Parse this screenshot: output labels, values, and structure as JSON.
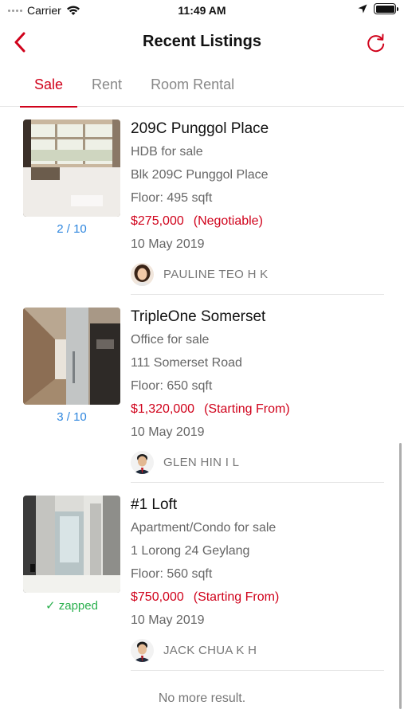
{
  "status_bar": {
    "carrier": "Carrier",
    "time": "11:49 AM"
  },
  "nav": {
    "title": "Recent Listings",
    "back_icon": "chevron-left-icon",
    "refresh_icon": "refresh-icon"
  },
  "tabs": [
    {
      "label": "Sale",
      "active": true
    },
    {
      "label": "Rent",
      "active": false
    },
    {
      "label": "Room Rental",
      "active": false
    }
  ],
  "listings": [
    {
      "title": "209C Punggol Place",
      "type": "HDB for sale",
      "address": "Blk 209C Punggol Place",
      "floor": "Floor: 495 sqft",
      "price": "$275,000",
      "price_note": "(Negotiable)",
      "date": "10 May 2019",
      "photo_label": "2 / 10",
      "agent": "PAULINE TEO H K"
    },
    {
      "title": "TripleOne Somerset",
      "type": "Office for sale",
      "address": "111 Somerset Road",
      "floor": "Floor: 650 sqft",
      "price": "$1,320,000",
      "price_note": "(Starting From)",
      "date": "10 May 2019",
      "photo_label": "3 / 10",
      "agent": "GLEN HIN I L"
    },
    {
      "title": "#1 Loft",
      "type": "Apartment/Condo for sale",
      "address": "1 Lorong 24 Geylang",
      "floor": "Floor: 560 sqft",
      "price": "$750,000",
      "price_note": "(Starting From)",
      "date": "10 May 2019",
      "photo_label": "✓ zapped",
      "agent": "JACK CHUA K H"
    }
  ],
  "footer": {
    "no_more": "No more result."
  },
  "colors": {
    "accent": "#d0021b",
    "link_blue": "#2e86de",
    "zapped_green": "#2ab04e"
  }
}
